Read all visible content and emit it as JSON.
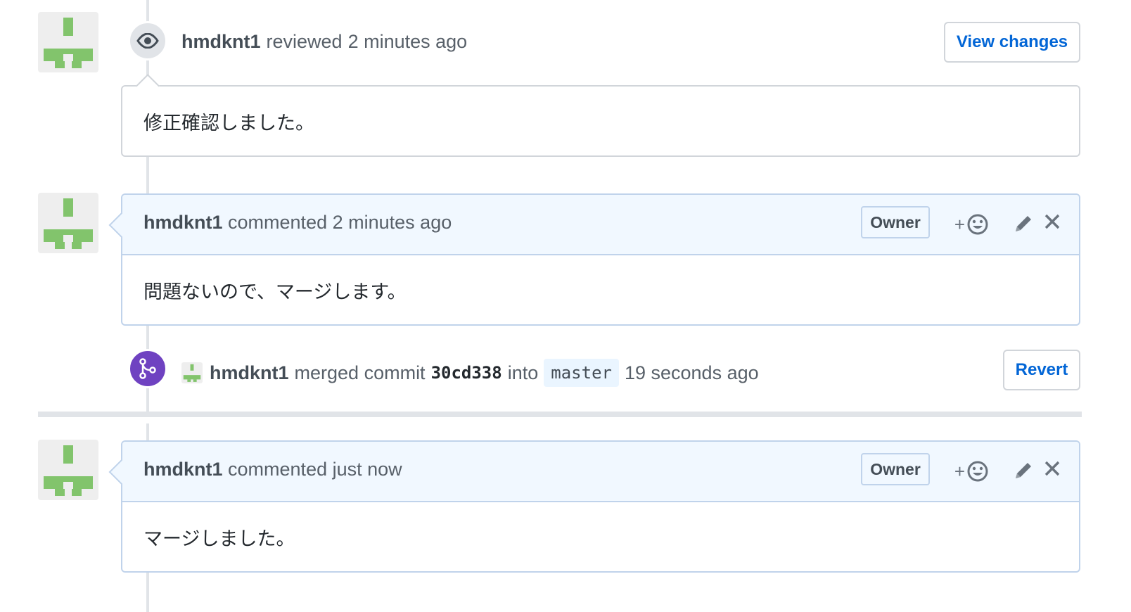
{
  "review_event": {
    "author": "hmdknt1",
    "action": "reviewed",
    "time": "2 minutes ago",
    "view_changes_label": "View changes",
    "body": "修正確認しました。"
  },
  "comments": [
    {
      "author": "hmdknt1",
      "action": "commented",
      "time": "2 minutes ago",
      "role": "Owner",
      "body": "問題ないので、マージします。"
    },
    {
      "author": "hmdknt1",
      "action": "commented",
      "time": "just now",
      "role": "Owner",
      "body": "マージしました。"
    }
  ],
  "merge_event": {
    "author": "hmdknt1",
    "action": "merged commit",
    "sha": "30cd338",
    "into": "into",
    "branch": "master",
    "time": "19 seconds ago",
    "revert_label": "Revert"
  },
  "icons": {
    "review": "eye-icon",
    "merge": "git-merge-icon",
    "reaction": "smiley-icon",
    "edit": "pencil-icon",
    "delete": "x-icon"
  },
  "colors": {
    "avatar_green": "#82c46c",
    "link_blue": "#0366d6",
    "merge_purple": "#6f42c1",
    "header_blue": "#f1f8ff"
  }
}
